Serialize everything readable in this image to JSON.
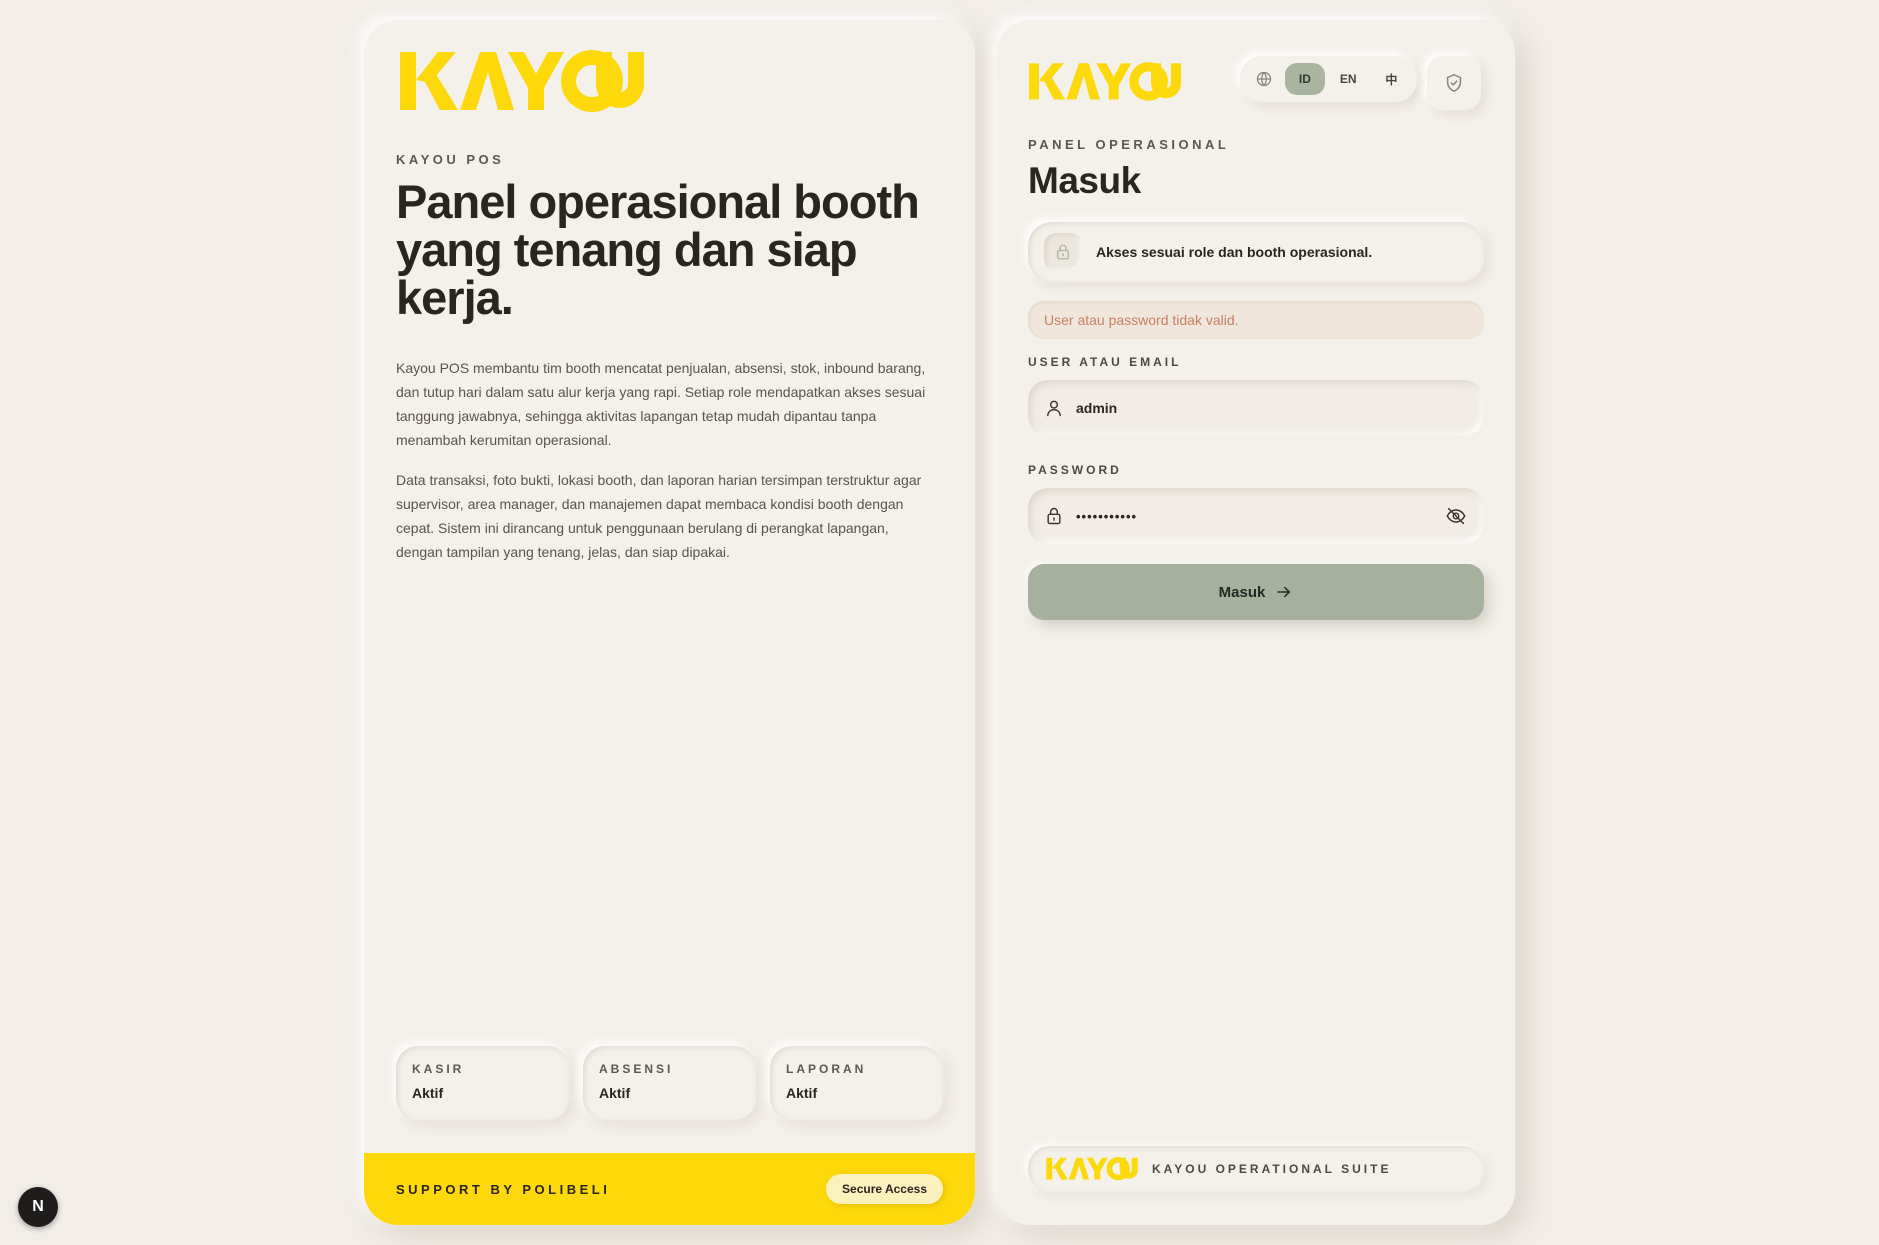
{
  "brand": {
    "logo_text": "KAYOU",
    "accent_yellow": "#fdd80b",
    "sage_green": "#a6b19d"
  },
  "left": {
    "eyebrow": "KAYOU POS",
    "title": "Panel operasional booth yang tenang dan siap kerja.",
    "paragraph_1": "Kayou POS membantu tim booth mencatat penjualan, absensi, stok, inbound barang, dan tutup hari dalam satu alur kerja yang rapi. Setiap role mendapatkan akses sesuai tanggung jawabnya, sehingga aktivitas lapangan tetap mudah dipantau tanpa menambah kerumitan operasional.",
    "paragraph_2": "Data transaksi, foto bukti, lokasi booth, dan laporan harian tersimpan terstruktur agar supervisor, area manager, dan manajemen dapat membaca kondisi booth dengan cepat. Sistem ini dirancang untuk penggunaan berulang di perangkat lapangan, dengan tampilan yang tenang, jelas, dan siap dipakai.",
    "stats": [
      {
        "label": "KASIR",
        "value": "Aktif"
      },
      {
        "label": "ABSENSI",
        "value": "Aktif"
      },
      {
        "label": "LAPORAN",
        "value": "Aktif"
      }
    ],
    "support_text": "SUPPORT BY POLIBELI",
    "secure_label": "Secure Access"
  },
  "right": {
    "languages": [
      "ID",
      "EN",
      "中"
    ],
    "active_language": "ID",
    "eyebrow": "PANEL OPERASIONAL",
    "title": "Masuk",
    "info_text": "Akses sesuai role dan booth operasional.",
    "error_text": "User atau password tidak valid.",
    "user_label": "USER ATAU EMAIL",
    "user_value": "admin",
    "password_label": "PASSWORD",
    "password_value": "•••••••••••",
    "submit_label": "Masuk",
    "suite_text": "KAYOU OPERATIONAL SUITE"
  },
  "dev_badge": "N"
}
